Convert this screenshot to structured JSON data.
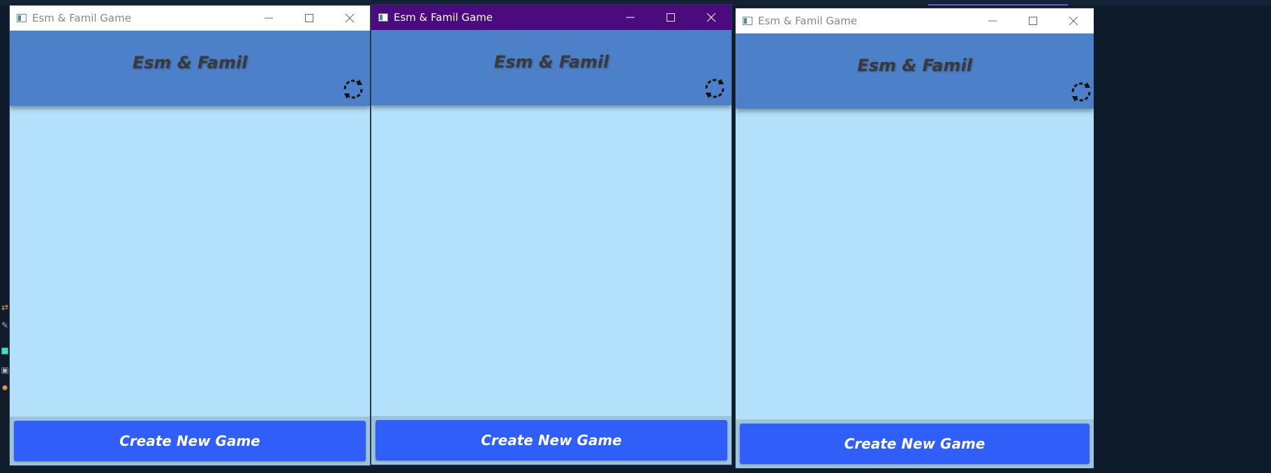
{
  "windows": [
    {
      "title": "Esm & Famil Game",
      "header_title": "Esm & Famil",
      "create_button": "Create New Game",
      "active": false
    },
    {
      "title": "Esm & Famil Game",
      "header_title": "Esm & Famil",
      "create_button": "Create New Game",
      "active": true
    },
    {
      "title": "Esm & Famil Game",
      "header_title": "Esm & Famil",
      "create_button": "Create New Game",
      "active": false
    }
  ],
  "icons": {
    "app": "app-window-icon",
    "minimize": "minimize-icon",
    "maximize": "maximize-icon",
    "close": "close-icon",
    "refresh": "refresh-icon"
  },
  "colors": {
    "header": "#4c80c8",
    "body": "#b3e0fb",
    "button": "#2f5ef8",
    "active_titlebar": "#4b0a7d"
  }
}
